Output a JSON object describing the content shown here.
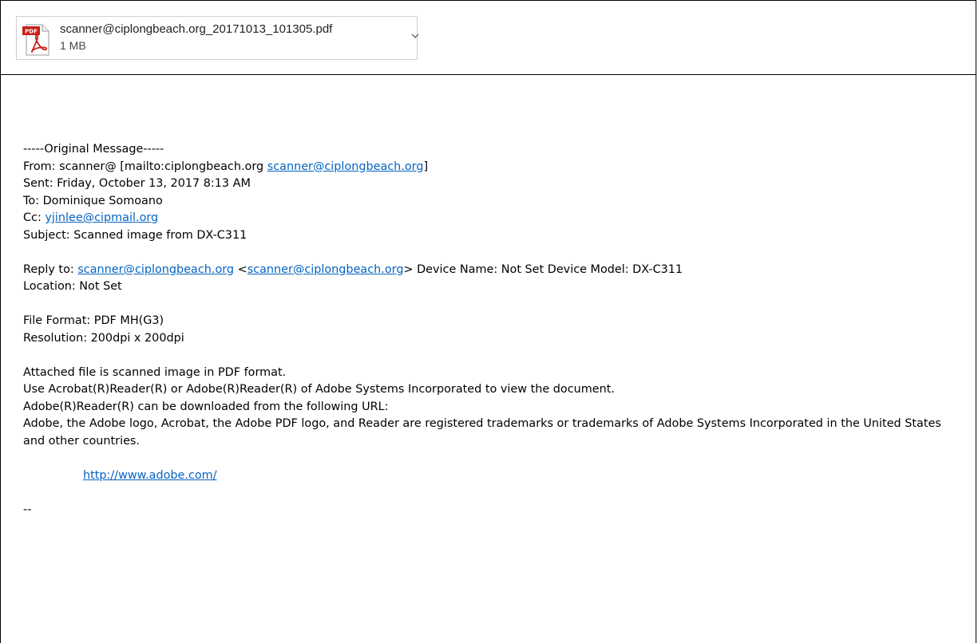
{
  "attachment": {
    "filename": "scanner@ciplongbeach.org_20171013_101305.pdf",
    "size": "1 MB",
    "icon": "pdf-file-icon",
    "menu_icon": "chevron-down-icon"
  },
  "message": {
    "separator": "-----Original Message-----",
    "from_prefix": "From: scanner@ [mailto:ciplongbeach.org ",
    "from_link": "scanner@ciplongbeach.org",
    "from_suffix": "]",
    "sent": "Sent: Friday, October 13, 2017 8:13 AM",
    "to": "To: Dominique Somoano",
    "cc_label": "Cc: ",
    "cc_link": "yjinlee@cipmail.org",
    "subject": "Subject: Scanned image from DX-C311",
    "reply_label": "Reply to: ",
    "reply_link1": "scanner@ciplongbeach.org",
    "reply_lt": " <",
    "reply_link2": "scanner@ciplongbeach.org",
    "reply_gt_device": "> Device Name: Not Set Device Model: DX-C311",
    "location": "Location: Not Set",
    "file_format": "File Format: PDF MH(G3)",
    "resolution": "Resolution: 200dpi x 200dpi",
    "line_attached": "Attached file is scanned image in PDF format.",
    "line_use": "Use Acrobat(R)Reader(R) or Adobe(R)Reader(R) of Adobe Systems Incorporated to view the document.",
    "line_download": "Adobe(R)Reader(R) can be downloaded from the following URL:",
    "line_trademark": "Adobe, the Adobe logo, Acrobat, the Adobe PDF logo, and Reader are registered trademarks or trademarks of Adobe Systems Incorporated in the United States and other countries.",
    "adobe_link": "http://www.adobe.com/",
    "signature_sep": "--"
  },
  "colors": {
    "link": "#0563c1",
    "pdf_red": "#c8201b"
  }
}
